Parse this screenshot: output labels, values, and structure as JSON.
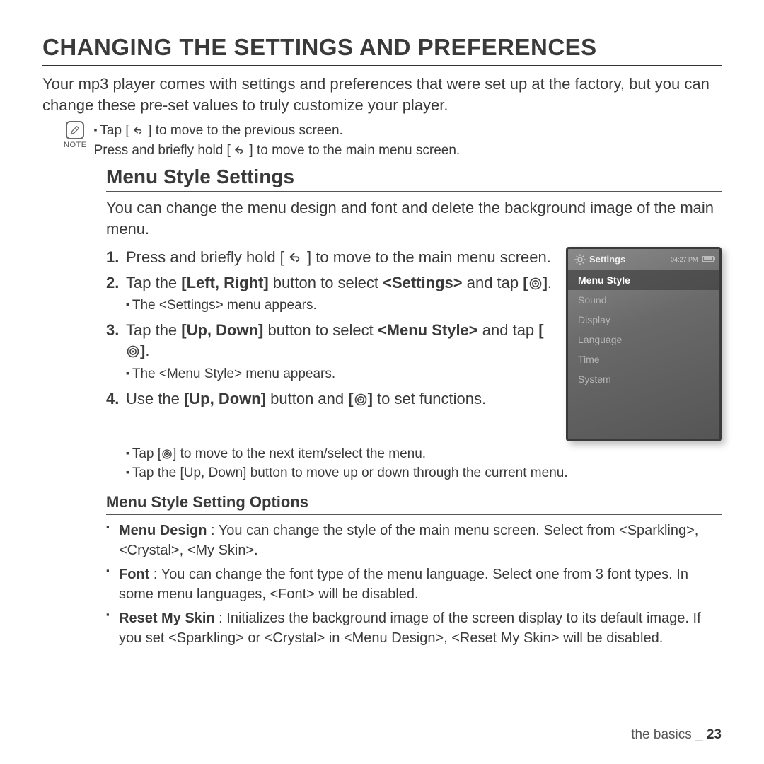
{
  "title": "CHANGING THE SETTINGS AND PREFERENCES",
  "intro": "Your mp3 player comes with settings and preferences that were set up at the factory, but you can change these pre-set values to truly customize your player.",
  "note": {
    "label": "NOTE",
    "line1_a": "Tap [",
    "line1_b": "] to move to the previous screen.",
    "line2_a": "Press and briefly hold [",
    "line2_b": "] to move to the main menu screen."
  },
  "section": {
    "title": "Menu Style Settings",
    "intro": "You can change the menu design and font and delete the background image of the main menu.",
    "steps": {
      "s1_a": "Press and briefly hold [",
      "s1_b": "] to move to the main menu screen.",
      "s2_a": "Tap the ",
      "s2_bold1": "[Left, Right]",
      "s2_b": " button to select ",
      "s2_bold2": "<Settings>",
      "s2_c": " and tap ",
      "s2_d": ".",
      "s2_sub": "The <Settings> menu appears.",
      "s3_a": "Tap the ",
      "s3_bold1": "[Up, Down]",
      "s3_b": " button to select ",
      "s3_bold2": "<Menu Style>",
      "s3_c": " and tap ",
      "s3_d": ".",
      "s3_sub": "The <Menu Style> menu appears.",
      "s4_a": "Use the ",
      "s4_bold1": "[Up, Down]",
      "s4_b": " button and ",
      "s4_c": " to set functions.",
      "s4_sub1_a": "Tap [",
      "s4_sub1_b": "] to move to the next item/select the menu.",
      "s4_sub2": "Tap the [Up, Down] button to move up or down through the current menu."
    },
    "subTitle": "Menu Style Setting Options",
    "options": {
      "o1_bold": "Menu Design",
      "o1_text": " : You can change the style of the main menu screen. Select from <Sparkling>, <Crystal>, <My Skin>.",
      "o2_bold": "Font",
      "o2_text": " : You can change the font type of the menu language. Select one from 3 font types. In some menu languages, <Font> will be disabled.",
      "o3_bold": "Reset My Skin",
      "o3_text": " : Initializes the background image of the screen display to its default image. If you set <Sparkling> or <Crystal> in <Menu Design>, <Reset My Skin> will be disabled."
    }
  },
  "device": {
    "time": "04:27 PM",
    "title": "Settings",
    "items": [
      "Menu Style",
      "Sound",
      "Display",
      "Language",
      "Time",
      "System"
    ],
    "selectedIndex": 0
  },
  "footer": {
    "chapter": "the basics _ ",
    "page": "23"
  }
}
